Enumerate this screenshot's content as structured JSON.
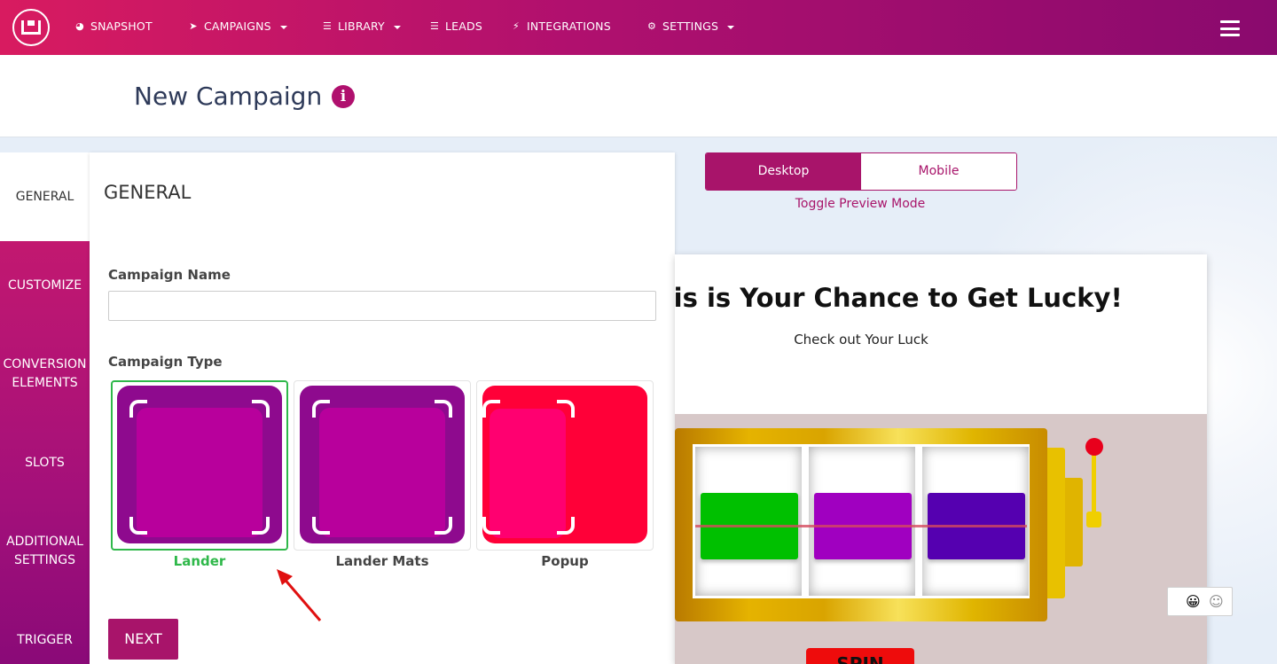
{
  "nav": {
    "items": [
      {
        "label": "SNAPSHOT",
        "icon": "dashboard-icon",
        "dropdown": false
      },
      {
        "label": "CAMPAIGNS",
        "icon": "paper-plane-icon",
        "dropdown": true
      },
      {
        "label": "LIBRARY",
        "icon": "list-icon",
        "dropdown": true
      },
      {
        "label": "LEADS",
        "icon": "list-icon",
        "dropdown": false
      },
      {
        "label": "INTEGRATIONS",
        "icon": "plug-icon",
        "dropdown": false
      },
      {
        "label": "SETTINGS",
        "icon": "cogs-icon",
        "dropdown": true
      }
    ]
  },
  "page": {
    "title": "New Campaign",
    "info_icon": "info-icon"
  },
  "sidetabs": [
    {
      "label": "GENERAL",
      "active": true
    },
    {
      "label": "CUSTOMIZE",
      "active": false
    },
    {
      "label": "CONVERSION ELEMENTS",
      "active": false
    },
    {
      "label": "SLOTS",
      "active": false
    },
    {
      "label": "ADDITIONAL SETTINGS",
      "active": false
    },
    {
      "label": "TRIGGER",
      "active": false
    }
  ],
  "general": {
    "heading": "GENERAL",
    "name_label": "Campaign Name",
    "name_value": "",
    "type_label": "Campaign Type",
    "types": [
      {
        "label": "Lander",
        "selected": true
      },
      {
        "label": "Lander Mats",
        "selected": false
      },
      {
        "label": "Popup",
        "selected": false
      }
    ],
    "next_label": "NEXT"
  },
  "preview": {
    "toggle_desktop": "Desktop",
    "toggle_mobile": "Mobile",
    "toggle_link": "Toggle Preview Mode",
    "title": "his is Your Chance to Get Lucky!",
    "subtitle": "Check out Your Luck",
    "spin_label": "SPIN",
    "reel_colors": [
      "#00c000",
      "#a000c0",
      "#5500b0"
    ]
  },
  "colors": {
    "brand": "#a8146a",
    "selected": "#2fb84a"
  }
}
